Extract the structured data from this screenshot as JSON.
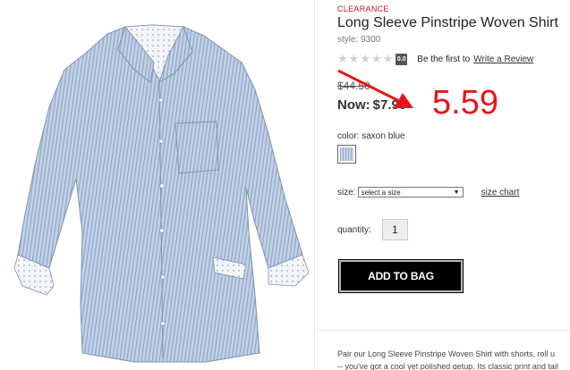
{
  "product": {
    "badge": "CLEARANCE",
    "title": "Long Sleeve Pinstripe Woven Shirt",
    "style": "style: 9300",
    "rating_value": "0.0",
    "rating_stars": 0,
    "first_review_text": "Be the first to",
    "write_review_label": "Write a Review",
    "old_price": "$44.50",
    "now_label": "Now:",
    "now_price": "$7.99",
    "color_label": "color: saxon blue",
    "size_label": "size:",
    "size_select_value": "select a size",
    "size_chart_label": "size chart",
    "quantity_label": "quantity:",
    "quantity_value": "1",
    "add_to_bag_label": "ADD TO BAG",
    "description_lines": [
      "Pair our Long Sleeve Pinstripe Woven Shirt with shorts, roll u",
      "-- you've got a cool yet polished getup. Its classic print and tail"
    ]
  },
  "annotation": {
    "price_text": "5.59",
    "color": "#e8141c"
  },
  "colors": {
    "clearance": "#c8102e",
    "button_bg": "#000000",
    "annotation": "#e8141c"
  }
}
